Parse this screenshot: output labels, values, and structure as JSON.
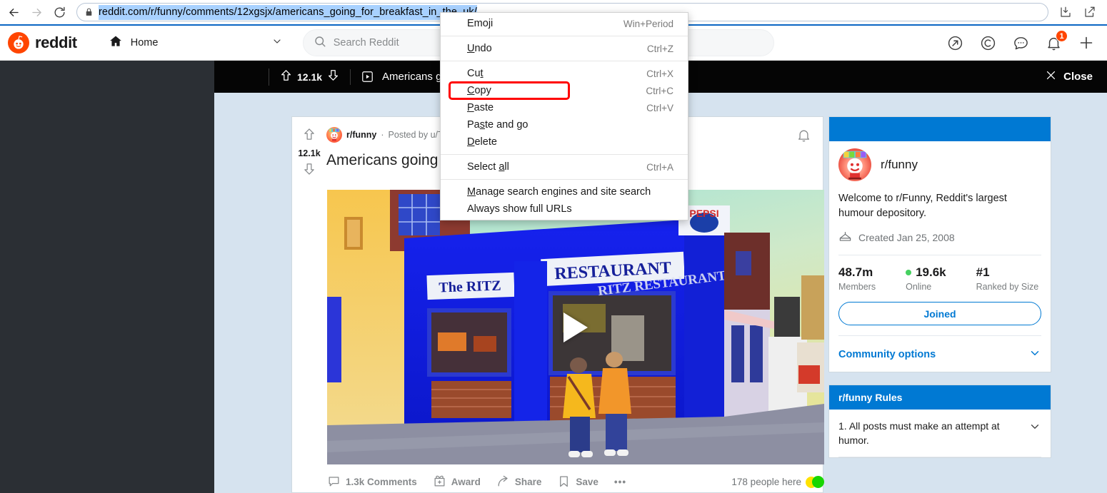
{
  "browser": {
    "back_icon": "arrow-left-icon",
    "forward_icon": "arrow-right-icon",
    "reload_icon": "reload-icon",
    "lock_icon": "lock-icon",
    "url": "reddit.com/r/funny/comments/12xgsjx/americans_going_for_breakfast_in_the_uk/",
    "download_icon": "download-icon",
    "share_icon": "share-icon"
  },
  "context_menu": {
    "groups": [
      [
        {
          "label": "Emoji",
          "accel": "Win+Period",
          "mnemonic": "",
          "highlighted": false
        }
      ],
      [
        {
          "label": "Undo",
          "accel": "Ctrl+Z",
          "mnemonic": "U",
          "highlighted": false
        }
      ],
      [
        {
          "label": "Cut",
          "accel": "Ctrl+X",
          "mnemonic": "t",
          "highlighted": false
        },
        {
          "label": "Copy",
          "accel": "Ctrl+C",
          "mnemonic": "C",
          "highlighted": true
        },
        {
          "label": "Paste",
          "accel": "Ctrl+V",
          "mnemonic": "P",
          "highlighted": false
        },
        {
          "label": "Paste and go",
          "accel": "",
          "mnemonic": "s",
          "highlighted": false
        },
        {
          "label": "Delete",
          "accel": "",
          "mnemonic": "D",
          "highlighted": false
        }
      ],
      [
        {
          "label": "Select all",
          "accel": "Ctrl+A",
          "mnemonic": "a",
          "highlighted": false
        }
      ],
      [
        {
          "label": "Manage search engines and site search",
          "accel": "",
          "mnemonic": "M",
          "highlighted": false
        },
        {
          "label": "Always show full URLs",
          "accel": "",
          "mnemonic": "",
          "highlighted": false
        }
      ]
    ],
    "highlight_color": "#ff0000"
  },
  "reddit_header": {
    "logo_text": "reddit",
    "logo_color": "#ff4500",
    "home_label": "Home",
    "home_icon": "home-icon",
    "chevron_icon": "chevron-down-icon",
    "search_placeholder": "Search Reddit",
    "search_icon": "search-icon",
    "icons": [
      {
        "name": "popular-icon",
        "glyph": "arrow-up-right"
      },
      {
        "name": "coins-icon",
        "glyph": "coin-c"
      },
      {
        "name": "chat-icon",
        "glyph": "chat-bubble"
      },
      {
        "name": "notifications-icon",
        "glyph": "bell",
        "badge": "1"
      },
      {
        "name": "create-post-icon",
        "glyph": "plus"
      }
    ]
  },
  "lightbox": {
    "score": "12.1k",
    "upvote_icon": "upvote-arrow-icon",
    "downvote_icon": "downvote-arrow-icon",
    "media_type_icon": "video-play-icon",
    "title": "Americans going for breakfast in the UK",
    "close_label": "Close",
    "close_icon": "close-x-icon"
  },
  "post": {
    "score": "12.1k",
    "subreddit": "r/funny",
    "separator": "·",
    "posted_by": "Posted by u/TasteMyYogurt 6 hours ago",
    "title": "Americans going for breakfast in the UK",
    "bell_icon": "notify-bell-icon",
    "play_icon": "play-triangle-icon",
    "actions": [
      {
        "name": "comments-button",
        "icon": "comment-bubble-icon",
        "label": "1.3k Comments"
      },
      {
        "name": "award-button",
        "icon": "award-gift-icon",
        "label": "Award"
      },
      {
        "name": "share-button",
        "icon": "share-arrow-icon",
        "label": "Share"
      },
      {
        "name": "save-button",
        "icon": "bookmark-icon",
        "label": "Save"
      },
      {
        "name": "more-options-button",
        "icon": "ellipsis-icon",
        "label": "•••"
      }
    ],
    "people_here": "178 people here",
    "dot_yellow": "#ffe200",
    "dot_green": "#18d600",
    "media_text": {
      "sign_left": "The RITZ",
      "sign_right": "RESTAURANT",
      "sign_corner": "RITZ RESTAURANT",
      "brand_sign": "PEPSI"
    }
  },
  "sidebar": {
    "about": {
      "banner_color": "#0079d3",
      "name": "r/funny",
      "description": "Welcome to r/Funny, Reddit's largest humour depository.",
      "created_icon": "cake-icon",
      "created": "Created Jan 25, 2008",
      "stats": [
        {
          "value": "48.7m",
          "label": "Members",
          "dot": false
        },
        {
          "value": "19.6k",
          "label": "Online",
          "dot": true
        },
        {
          "value": "#1",
          "label": "Ranked by Size",
          "dot": false
        }
      ],
      "join_button": "Joined",
      "community_options": "Community options",
      "community_chevron": "chevron-down-icon"
    },
    "rules": {
      "banner_color": "#0079d3",
      "title": "r/funny Rules",
      "items": [
        {
          "num": "1.",
          "text": "All posts must make an attempt at humor.",
          "chevron": "chevron-down-icon"
        }
      ]
    }
  }
}
